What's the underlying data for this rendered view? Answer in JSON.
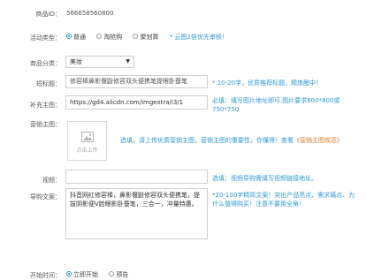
{
  "product_id": {
    "label": "商品ID：",
    "value": "566658560800"
  },
  "activity_type": {
    "label": "活动类型：",
    "options": [
      {
        "label": "普通",
        "selected": true
      },
      {
        "label": "淘抢购",
        "selected": false
      },
      {
        "label": "聚划算",
        "selected": false
      }
    ],
    "hint": "* 云图2倍优先审核！"
  },
  "category": {
    "label": "商品分类：",
    "value": "美妆"
  },
  "short_title": {
    "label": "短标题：",
    "value": "修容棒鼻影偃鼢修容双头便携笔提眼卧蚕笔",
    "hint": "* 10-20字，优质推荐标题，精炼醒中！"
  },
  "extra_image": {
    "label": "补充主图：",
    "value": "https://gd4.alicdn.com/imgextra/i3/1",
    "hint": "必填：填写图片地址即可,图片要求800*800或750*750"
  },
  "marketing_image": {
    "label": "营销主图：",
    "upload_text": "点击上传",
    "hint_prefix": "选填，请上传优质营销主图，营销主图的重要性，你懂得！查看",
    "hint_link": "《营销主图规范》"
  },
  "video": {
    "label": "视频：",
    "value": "",
    "hint": "选填：视频导购需填写视频链接地址。"
  },
  "copy": {
    "label": "导购文案：",
    "value": "抖音网红修容棒，鼻影偃鼢修容双头便携笔，提拔阴影便V脸眼影卧蚕笔，三合一，冲量特惠。",
    "hint": "*20-100字精简文案！突出产品亮点、需求痛点、为什么值得购买！注意不要用全角！"
  },
  "start_time": {
    "label": "开始时间：",
    "options": [
      {
        "label": "立即开始",
        "selected": true
      },
      {
        "label": "预告",
        "selected": false
      }
    ]
  },
  "colors": {
    "accent": "#2f9ad6",
    "link": "#e07b2a",
    "border": "#cfcfcf"
  }
}
